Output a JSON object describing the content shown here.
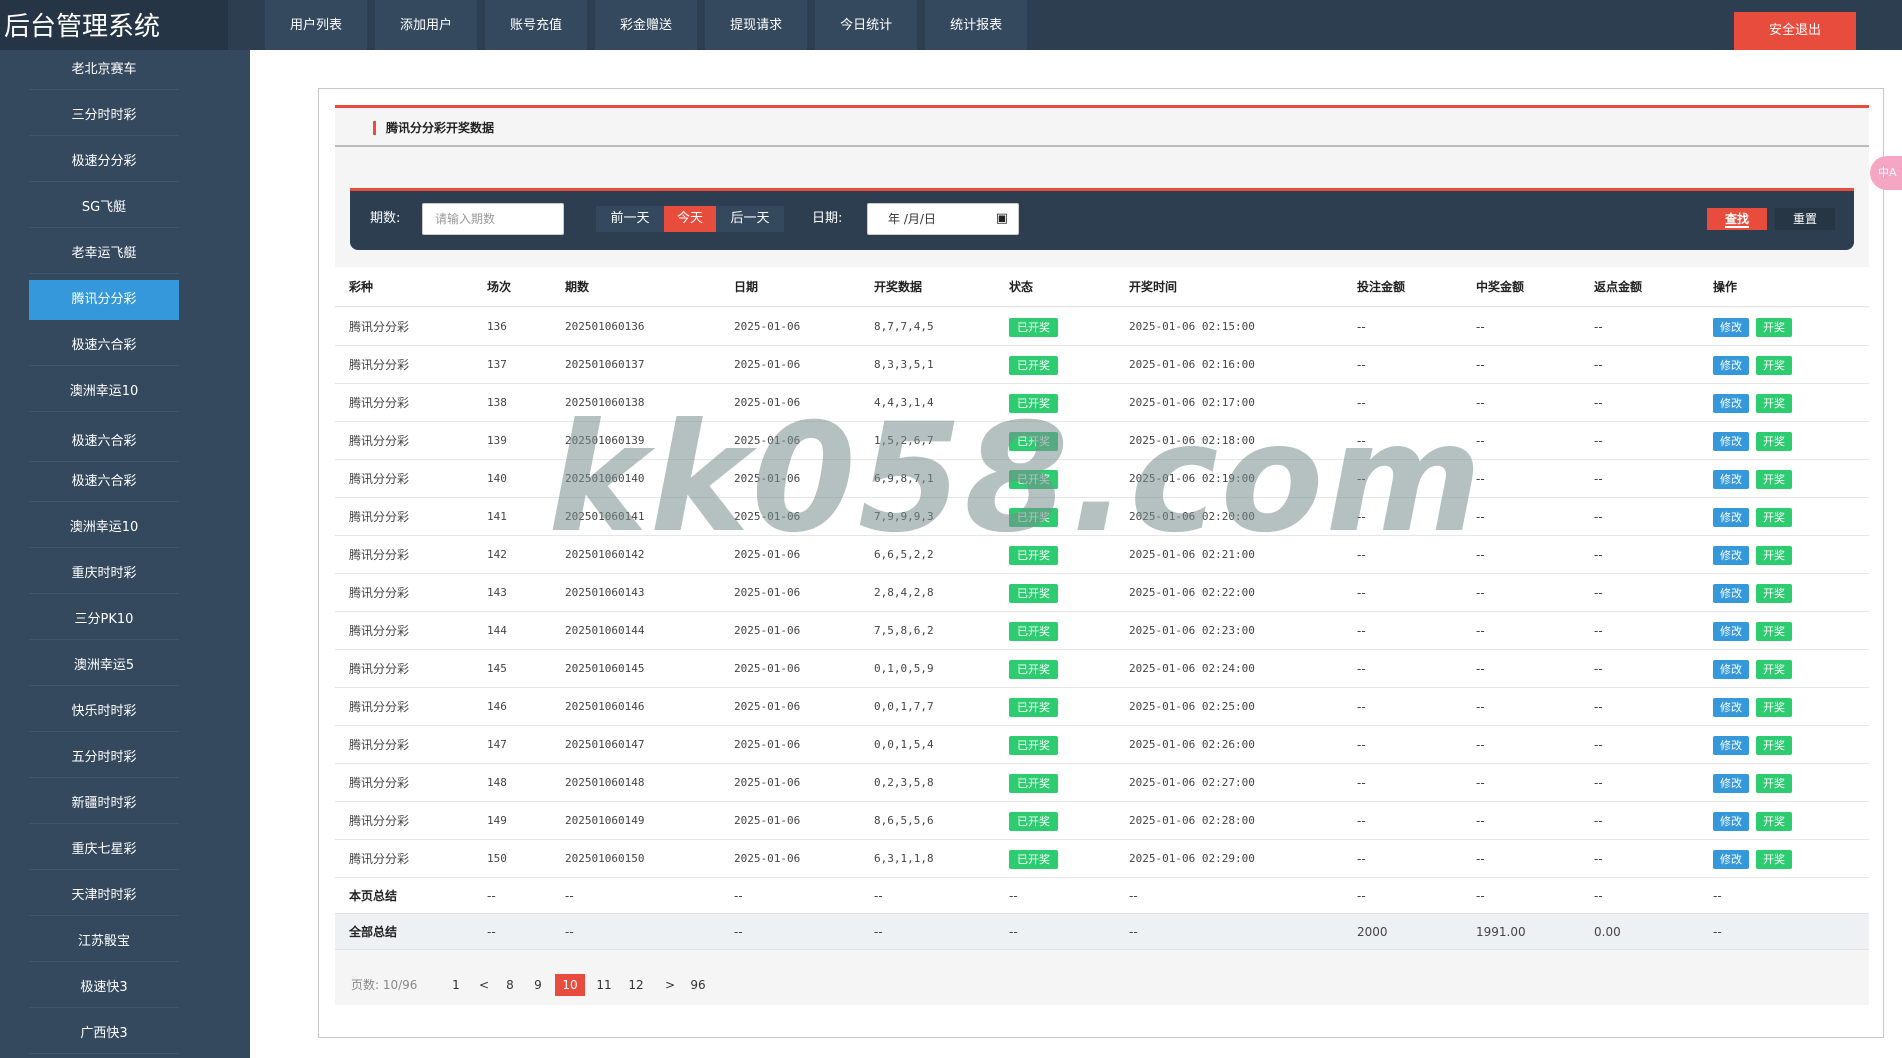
{
  "app": {
    "title": "后台管理系统"
  },
  "topnav": [
    "用户列表",
    "添加用户",
    "账号充值",
    "彩金赠送",
    "提现请求",
    "今日统计",
    "统计报表"
  ],
  "logout_label": "安全退出",
  "sidebar": [
    {
      "label": "老北京赛车",
      "active": false
    },
    {
      "label": "三分时时彩",
      "active": false
    },
    {
      "label": "极速分分彩",
      "active": false
    },
    {
      "label": "SG飞艇",
      "active": false
    },
    {
      "label": "老幸运飞艇",
      "active": false
    },
    {
      "label": "腾讯分分彩",
      "active": true
    },
    {
      "label": "极速六合彩",
      "active": false
    },
    {
      "label": "澳洲幸运10",
      "active": false
    },
    {
      "label": "极速六合彩",
      "active": false
    },
    {
      "label": "极速六合彩",
      "active": false
    },
    {
      "label": "澳洲幸运10",
      "active": false
    },
    {
      "label": "重庆时时彩",
      "active": false
    },
    {
      "label": "三分PK10",
      "active": false
    },
    {
      "label": "澳洲幸运5",
      "active": false
    },
    {
      "label": "快乐时时彩",
      "active": false
    },
    {
      "label": "五分时时彩",
      "active": false
    },
    {
      "label": "新疆时时彩",
      "active": false
    },
    {
      "label": "重庆七星彩",
      "active": false
    },
    {
      "label": "天津时时彩",
      "active": false
    },
    {
      "label": "江苏骰宝",
      "active": false
    },
    {
      "label": "极速快3",
      "active": false
    },
    {
      "label": "广西快3",
      "active": false
    }
  ],
  "panel": {
    "title": "腾讯分分彩开奖数据"
  },
  "filter": {
    "period_label": "期数:",
    "period_placeholder": "请输入期数",
    "prev_day": "前一天",
    "today": "今天",
    "next_day": "后一天",
    "date_label": "日期:",
    "date_value": "年 /月/日",
    "search": "查找",
    "reset": "重置"
  },
  "table": {
    "headers": [
      "彩种",
      "场次",
      "期数",
      "日期",
      "开奖数据",
      "状态",
      "开奖时间",
      "投注金额",
      "中奖金额",
      "返点金额",
      "操作"
    ],
    "rows": [
      {
        "game": "腾讯分分彩",
        "round": "136",
        "period": "202501060136",
        "date": "2025-01-06",
        "result": "8,7,7,4,5",
        "status": "已开奖",
        "time": "2025-01-06 02:15:00",
        "bet": "--",
        "win": "--",
        "rebate": "--"
      },
      {
        "game": "腾讯分分彩",
        "round": "137",
        "period": "202501060137",
        "date": "2025-01-06",
        "result": "8,3,3,5,1",
        "status": "已开奖",
        "time": "2025-01-06 02:16:00",
        "bet": "--",
        "win": "--",
        "rebate": "--"
      },
      {
        "game": "腾讯分分彩",
        "round": "138",
        "period": "202501060138",
        "date": "2025-01-06",
        "result": "4,4,3,1,4",
        "status": "已开奖",
        "time": "2025-01-06 02:17:00",
        "bet": "--",
        "win": "--",
        "rebate": "--"
      },
      {
        "game": "腾讯分分彩",
        "round": "139",
        "period": "202501060139",
        "date": "2025-01-06",
        "result": "1,5,2,6,7",
        "status": "已开奖",
        "time": "2025-01-06 02:18:00",
        "bet": "--",
        "win": "--",
        "rebate": "--"
      },
      {
        "game": "腾讯分分彩",
        "round": "140",
        "period": "202501060140",
        "date": "2025-01-06",
        "result": "6,9,8,7,1",
        "status": "已开奖",
        "time": "2025-01-06 02:19:00",
        "bet": "--",
        "win": "--",
        "rebate": "--"
      },
      {
        "game": "腾讯分分彩",
        "round": "141",
        "period": "202501060141",
        "date": "2025-01-06",
        "result": "7,9,9,9,3",
        "status": "已开奖",
        "time": "2025-01-06 02:20:00",
        "bet": "--",
        "win": "--",
        "rebate": "--"
      },
      {
        "game": "腾讯分分彩",
        "round": "142",
        "period": "202501060142",
        "date": "2025-01-06",
        "result": "6,6,5,2,2",
        "status": "已开奖",
        "time": "2025-01-06 02:21:00",
        "bet": "--",
        "win": "--",
        "rebate": "--"
      },
      {
        "game": "腾讯分分彩",
        "round": "143",
        "period": "202501060143",
        "date": "2025-01-06",
        "result": "2,8,4,2,8",
        "status": "已开奖",
        "time": "2025-01-06 02:22:00",
        "bet": "--",
        "win": "--",
        "rebate": "--"
      },
      {
        "game": "腾讯分分彩",
        "round": "144",
        "period": "202501060144",
        "date": "2025-01-06",
        "result": "7,5,8,6,2",
        "status": "已开奖",
        "time": "2025-01-06 02:23:00",
        "bet": "--",
        "win": "--",
        "rebate": "--"
      },
      {
        "game": "腾讯分分彩",
        "round": "145",
        "period": "202501060145",
        "date": "2025-01-06",
        "result": "0,1,0,5,9",
        "status": "已开奖",
        "time": "2025-01-06 02:24:00",
        "bet": "--",
        "win": "--",
        "rebate": "--"
      },
      {
        "game": "腾讯分分彩",
        "round": "146",
        "period": "202501060146",
        "date": "2025-01-06",
        "result": "0,0,1,7,7",
        "status": "已开奖",
        "time": "2025-01-06 02:25:00",
        "bet": "--",
        "win": "--",
        "rebate": "--"
      },
      {
        "game": "腾讯分分彩",
        "round": "147",
        "period": "202501060147",
        "date": "2025-01-06",
        "result": "0,0,1,5,4",
        "status": "已开奖",
        "time": "2025-01-06 02:26:00",
        "bet": "--",
        "win": "--",
        "rebate": "--"
      },
      {
        "game": "腾讯分分彩",
        "round": "148",
        "period": "202501060148",
        "date": "2025-01-06",
        "result": "0,2,3,5,8",
        "status": "已开奖",
        "time": "2025-01-06 02:27:00",
        "bet": "--",
        "win": "--",
        "rebate": "--"
      },
      {
        "game": "腾讯分分彩",
        "round": "149",
        "period": "202501060149",
        "date": "2025-01-06",
        "result": "8,6,5,5,6",
        "status": "已开奖",
        "time": "2025-01-06 02:28:00",
        "bet": "--",
        "win": "--",
        "rebate": "--"
      },
      {
        "game": "腾讯分分彩",
        "round": "150",
        "period": "202501060150",
        "date": "2025-01-06",
        "result": "6,3,1,1,8",
        "status": "已开奖",
        "time": "2025-01-06 02:29:00",
        "bet": "--",
        "win": "--",
        "rebate": "--"
      }
    ],
    "edit_label": "修改",
    "open_label": "开奖",
    "page_summary": {
      "label": "本页总结",
      "values": [
        "--",
        "--",
        "--",
        "--",
        "--",
        "--",
        "--",
        "--",
        "--",
        "--"
      ]
    },
    "total_summary": {
      "label": "全部总结",
      "values": [
        "--",
        "--",
        "--",
        "--",
        "--",
        "--",
        "2000",
        "1991.00",
        "0.00",
        "--"
      ]
    }
  },
  "pagination": {
    "info": "页数: 10/96",
    "pages": [
      "1",
      "<",
      "8",
      "9",
      "10",
      "11",
      "12",
      ">",
      "96"
    ],
    "current": "10"
  },
  "watermark": "kk058.com",
  "side_tab": "中A",
  "colors": {
    "accent": "#e74c3c",
    "primary": "#3498db",
    "success": "#2ecc71",
    "nav": "#2c3e50",
    "sidebar": "#34495e"
  }
}
